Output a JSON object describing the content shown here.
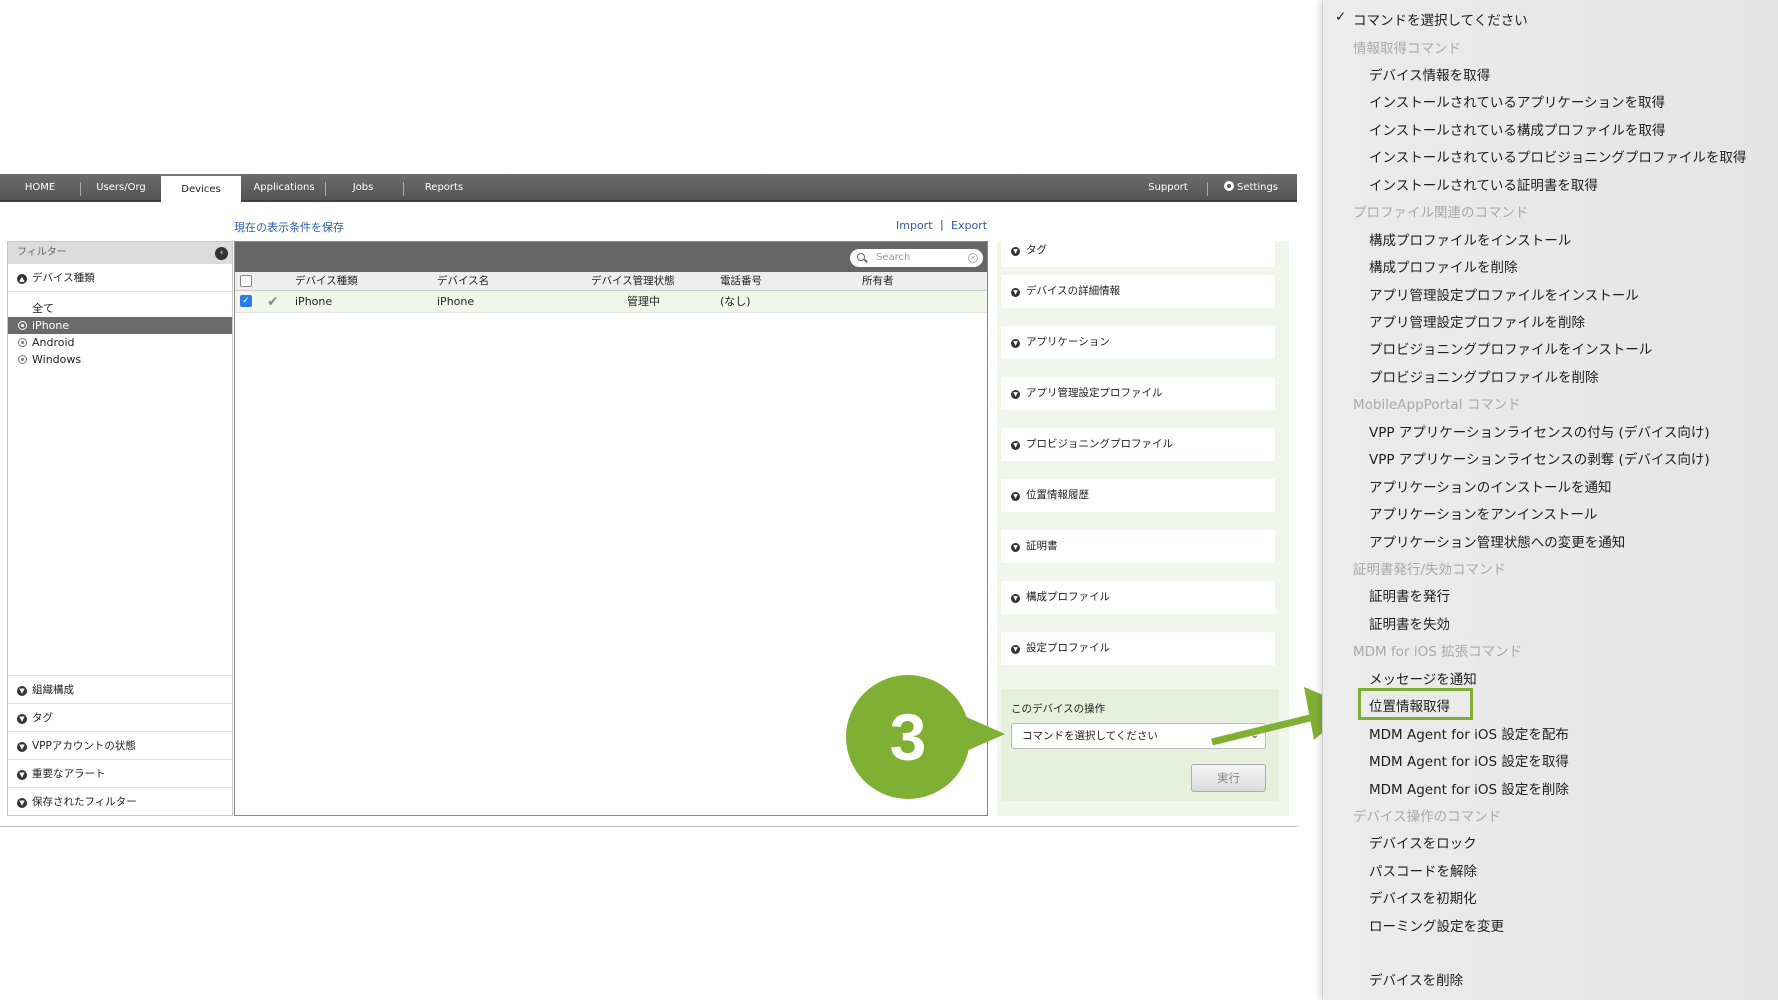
{
  "nav": {
    "tabs": [
      "HOME",
      "Users/Org",
      "Devices",
      "Applications",
      "Jobs",
      "Reports"
    ],
    "support": "Support",
    "settings": "Settings"
  },
  "toolbar": {
    "save_view": "現在の表示条件を保存",
    "import": "Import",
    "separator": "|",
    "export": "Export"
  },
  "filter": {
    "title": "フィルター",
    "device_type_header": "デバイス種類",
    "types": [
      "全て",
      "iPhone",
      "Android",
      "Windows"
    ],
    "selected": "iPhone",
    "bottom_sections": [
      "組織構成",
      "タグ",
      "VPPアカウントの状態",
      "重要なアラート",
      "保存されたフィルター"
    ]
  },
  "table": {
    "search_placeholder": "Search",
    "columns": [
      "デバイス種類",
      "デバイス名",
      "デバイス管理状態",
      "電話番号",
      "所有者"
    ],
    "rows": [
      {
        "type": "iPhone",
        "name": "iPhone",
        "status": "管理中",
        "phone": "(なし)",
        "owner": ""
      }
    ]
  },
  "details": {
    "sections": [
      "タグ",
      "デバイスの詳細情報",
      "アプリケーション",
      "アプリ管理設定プロファイル",
      "プロビジョニングプロファイル",
      "位置情報履歴",
      "証明書",
      "構成プロファイル",
      "設定プロファイル"
    ],
    "ops_title": "このデバイスの操作",
    "select_value": "コマンドを選択してください",
    "run_button": "実行"
  },
  "step_number": "3",
  "menu": {
    "checked": "コマンドを選択してください",
    "groups": [
      {
        "label": "情報取得コマンド",
        "items": [
          "デバイス情報を取得",
          "インストールされているアプリケーションを取得",
          "インストールされている構成プロファイルを取得",
          "インストールされているプロビジョニングプロファイルを取得",
          "インストールされている証明書を取得"
        ]
      },
      {
        "label": "プロファイル関連のコマンド",
        "items": [
          "構成プロファイルをインストール",
          "構成プロファイルを削除",
          "アプリ管理設定プロファイルをインストール",
          "アプリ管理設定プロファイルを削除",
          "プロビジョニングプロファイルをインストール",
          "プロビジョニングプロファイルを削除"
        ]
      },
      {
        "label": "MobileAppPortal コマンド",
        "items": [
          "VPP アプリケーションライセンスの付与 (デバイス向け)",
          "VPP アプリケーションライセンスの剥奪 (デバイス向け)",
          "アプリケーションのインストールを通知",
          "アプリケーションをアンインストール",
          "アプリケーション管理状態への変更を通知"
        ]
      },
      {
        "label": "証明書発行/失効コマンド",
        "items": [
          "証明書を発行",
          "証明書を失効"
        ]
      },
      {
        "label": "MDM for iOS 拡張コマンド",
        "items": [
          "メッセージを通知",
          "位置情報取得",
          "MDM Agent for iOS 設定を配布",
          "MDM Agent for iOS 設定を取得",
          "MDM Agent for iOS 設定を削除"
        ]
      },
      {
        "label": "デバイス操作のコマンド",
        "items": [
          "デバイスをロック",
          "パスコードを解除",
          "デバイスを初期化",
          "ローミング設定を変更"
        ]
      }
    ],
    "last_item": "デバイスを削除",
    "highlighted": "位置情報取得"
  },
  "colors": {
    "accent_green": "#7fb034",
    "nav_gray": "#5f5f5f",
    "link_blue": "#2a5fa8"
  }
}
